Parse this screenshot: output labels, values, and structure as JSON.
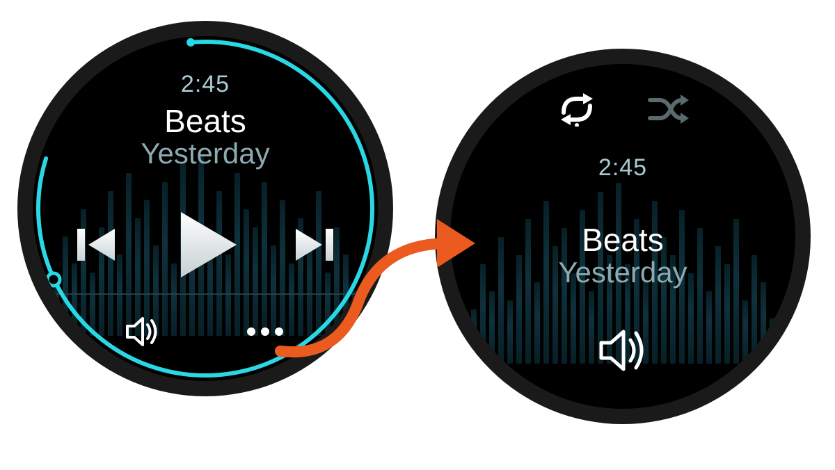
{
  "colors": {
    "accent": "#29d8e4",
    "arrow": "#eb5a1e"
  },
  "left": {
    "time": "2:45",
    "track": "Beats",
    "artist": "Yesterday",
    "icons": {
      "prev": "previous-track-icon",
      "play": "play-icon",
      "next": "next-track-icon",
      "volume": "volume-icon",
      "more": "more-icon"
    }
  },
  "right": {
    "time": "2:45",
    "track": "Beats",
    "artist": "Yesterday",
    "icons": {
      "repeat": "repeat-icon",
      "shuffle": "shuffle-icon",
      "volume": "volume-icon"
    }
  }
}
